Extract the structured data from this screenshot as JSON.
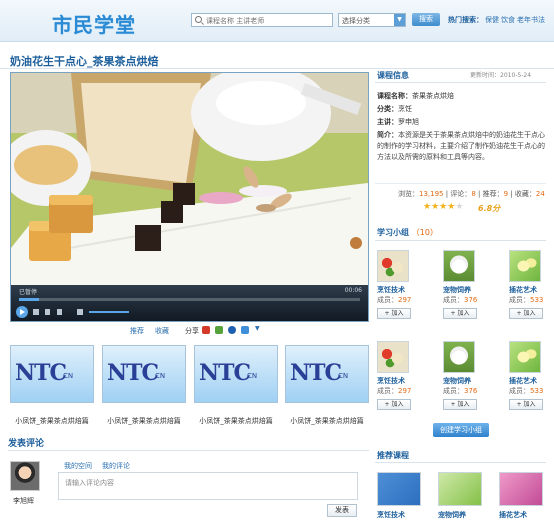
{
  "header": {
    "logo_text": "市民学堂",
    "search_placeholder": "课程名称 主讲老师",
    "select_value": "选择分类",
    "search_button": "搜索",
    "hot_label": "热门搜索：",
    "hot_links": [
      "保健",
      "饮食",
      "老年书法"
    ]
  },
  "course": {
    "title": "奶油花生干点心_茶果茶点烘焙",
    "player_status": "已暂停",
    "player_time": "00:06",
    "progress_fraction": 0.06,
    "actions": {
      "recommend": "推荐",
      "favorite": "收藏",
      "share": "分享"
    }
  },
  "related": [
    {
      "logo": "NTC",
      "tag": "CN",
      "caption": "小凤饼_茶果茶点烘焙篇"
    },
    {
      "logo": "NTC",
      "tag": "CN",
      "caption": "小凤饼_茶果茶点烘焙篇"
    },
    {
      "logo": "NTC",
      "tag": "CN",
      "caption": "小凤饼_茶果茶点烘焙篇"
    },
    {
      "logo": "NTC",
      "tag": "CN",
      "caption": "小凤饼_茶果茶点烘焙篇"
    }
  ],
  "comment": {
    "title": "发表评论",
    "user_name": "李旭辉",
    "tab_space": "我的空间",
    "tab_comments": "我的评论",
    "placeholder": "请输入评论内容",
    "send_button": "发表"
  },
  "course_info": {
    "heading": "课程信息",
    "updated": "更新时间：2010-5-24",
    "rows": [
      {
        "label": "课程名称：",
        "value": "茶果茶点烘焙"
      },
      {
        "label": "分类：",
        "value": "烹饪"
      },
      {
        "label": "主讲：",
        "value": "罗申旭"
      }
    ],
    "desc_label": "简介：",
    "desc": "本资源是关于茶果茶点烘焙中的奶油花生干点心的制作的学习材料，主要介绍了制作奶油花生干点心的方法以及所需的原料和工具等内容。",
    "stats": {
      "views_label": "浏览：",
      "views": "13,195",
      "comments_label": "评论：",
      "comments": "8",
      "recommend_label": "推荐：",
      "recommend": "9",
      "favorites_label": "收藏：",
      "favorites": "24"
    },
    "rating": "6.8分",
    "rating_stars": 4
  },
  "groups": {
    "heading": "学习小组",
    "count": "（10）",
    "join_label": "加入",
    "member_label": "成员：",
    "items": [
      {
        "name": "烹饪技术",
        "members": "297",
        "img": "food"
      },
      {
        "name": "宠物饲养",
        "members": "376",
        "img": "dog"
      },
      {
        "name": "插花艺术",
        "members": "533",
        "img": "flower"
      },
      {
        "name": "烹饪技术",
        "members": "297",
        "img": "food"
      },
      {
        "name": "宠物饲养",
        "members": "376",
        "img": "dog"
      },
      {
        "name": "插花艺术",
        "members": "533",
        "img": "flower"
      }
    ],
    "create_button": "创建学习小组"
  },
  "recommend": {
    "heading": "推荐课程",
    "items": [
      {
        "name": "烹饪技术"
      },
      {
        "name": "宠物饲养"
      },
      {
        "name": "插花艺术"
      }
    ]
  },
  "colors": {
    "accent": "#1d5f9c",
    "link": "#2a6fb0",
    "highlight": "#e36a12",
    "star": "#f4b21b"
  }
}
